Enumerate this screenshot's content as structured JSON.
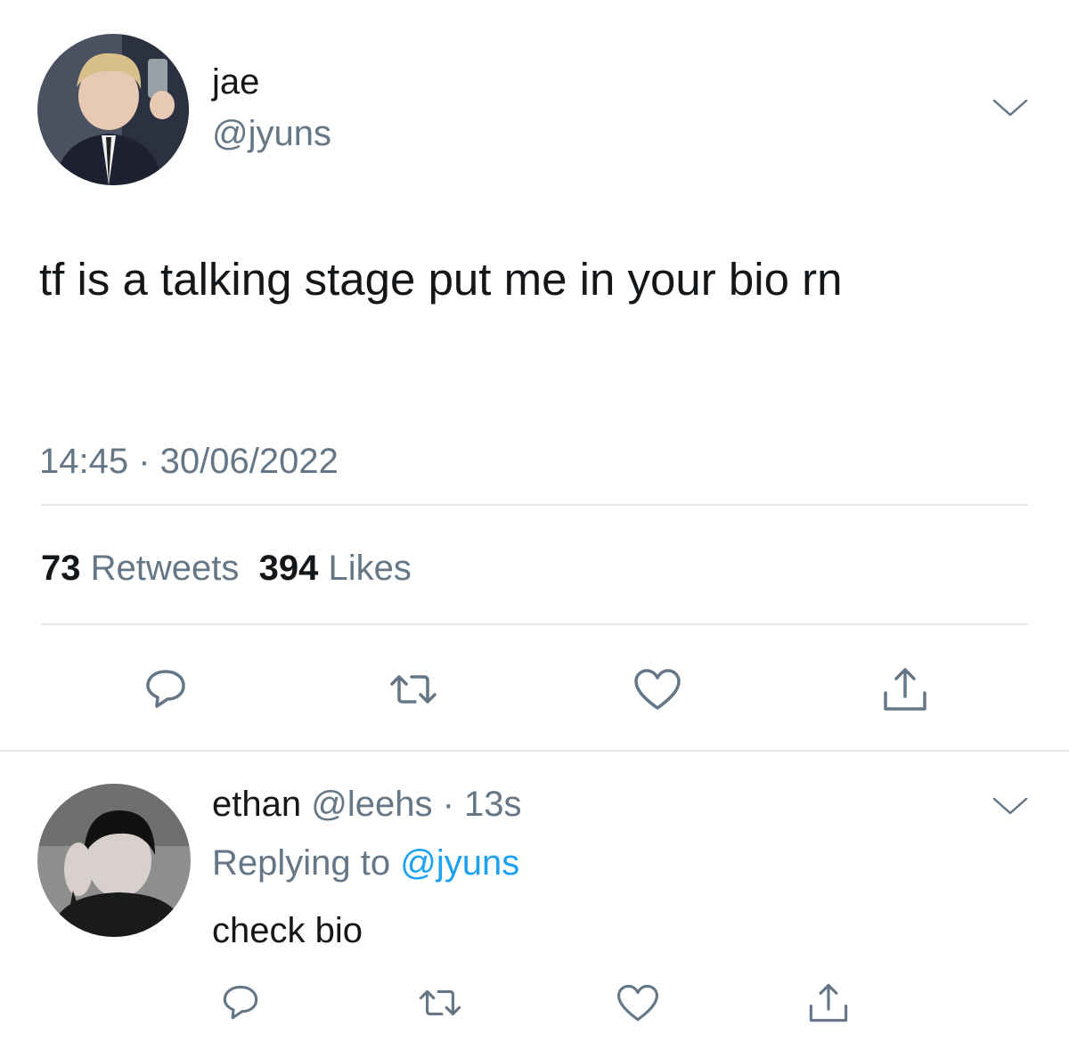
{
  "main_tweet": {
    "name": "jae",
    "handle": "@jyuns",
    "text": "tf is a talking stage put me in your bio rn",
    "timestamp": "14:45 · 30/06/2022",
    "retweets_count": "73",
    "retweets_label": "Retweets",
    "likes_count": "394",
    "likes_label": "Likes"
  },
  "reply_tweet": {
    "name": "ethan",
    "meta": "@leehs · 13s",
    "replying_prefix": "Replying to",
    "replying_handle": "@jyuns",
    "text": "check bio"
  },
  "icons": {
    "more": "chevron-down-icon",
    "reply": "reply-bubble-icon",
    "retweet": "retweet-icon",
    "like": "heart-icon",
    "share": "share-icon"
  },
  "colors": {
    "text_primary": "#14171a",
    "text_secondary": "#657786",
    "link": "#1da1f2",
    "divider": "#e1e8ed",
    "icon": "#657786"
  }
}
